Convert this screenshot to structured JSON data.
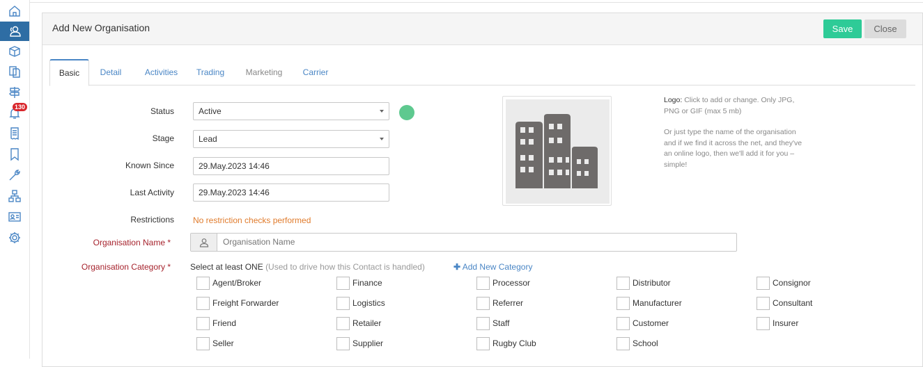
{
  "sidebar": {
    "items": [
      {
        "icon": "home-icon"
      },
      {
        "icon": "contacts-icon",
        "active": true
      },
      {
        "icon": "box-icon"
      },
      {
        "icon": "documents-icon"
      },
      {
        "icon": "signpost-icon"
      },
      {
        "icon": "bell-icon",
        "badge": "130"
      },
      {
        "icon": "receipt-icon"
      },
      {
        "icon": "bookmark-icon"
      },
      {
        "icon": "wrench-icon"
      },
      {
        "icon": "hierarchy-icon"
      },
      {
        "icon": "id-card-icon"
      },
      {
        "icon": "gear-icon"
      }
    ]
  },
  "header": {
    "title": "Add New Organisation",
    "save_label": "Save",
    "close_label": "Close"
  },
  "tabs": [
    {
      "label": "Basic",
      "active": true
    },
    {
      "label": "Detail"
    },
    {
      "label": "Activities"
    },
    {
      "label": "Trading"
    },
    {
      "label": "Marketing",
      "muted": true
    },
    {
      "label": "Carrier"
    }
  ],
  "form": {
    "status": {
      "label": "Status",
      "value": "Active"
    },
    "stage": {
      "label": "Stage",
      "value": "Lead"
    },
    "known_since": {
      "label": "Known Since",
      "value": "29.May.2023 14:46"
    },
    "last_activity": {
      "label": "Last Activity",
      "value": "29.May.2023 14:46"
    },
    "restrictions": {
      "label": "Restrictions",
      "value": "No restriction checks performed"
    },
    "org_name": {
      "label": "Organisation Name *",
      "placeholder": "Organisation Name"
    },
    "org_category": {
      "label": "Organisation Category *",
      "hint_main": "Select at least ONE",
      "hint_note": "(Used to drive how this Contact is handled)",
      "add_label": "Add New Category",
      "options": [
        [
          "Agent/Broker",
          "Finance",
          "Processor",
          "Distributor",
          "Consignor"
        ],
        [
          "Freight Forwarder",
          "Logistics",
          "Referrer",
          "Manufacturer",
          "Consultant"
        ],
        [
          "Friend",
          "Retailer",
          "Staff",
          "Customer",
          "Insurer"
        ],
        [
          "Seller",
          "Supplier",
          "Rugby Club",
          "School"
        ]
      ]
    }
  },
  "logo": {
    "help_title": "Logo:",
    "help_1": "Click to add or change. Only JPG, PNG or GIF (max 5 mb)",
    "help_2": "Or just type the name of the organisation and if we find it across the net, and they've an online logo, then we'll add it for you – simple!"
  },
  "colors": {
    "accent": "#4a86c5",
    "save": "#2ecb97",
    "status_dot": "#5ec98f",
    "required_label": "#a6232d",
    "warning": "#e07b2c"
  }
}
